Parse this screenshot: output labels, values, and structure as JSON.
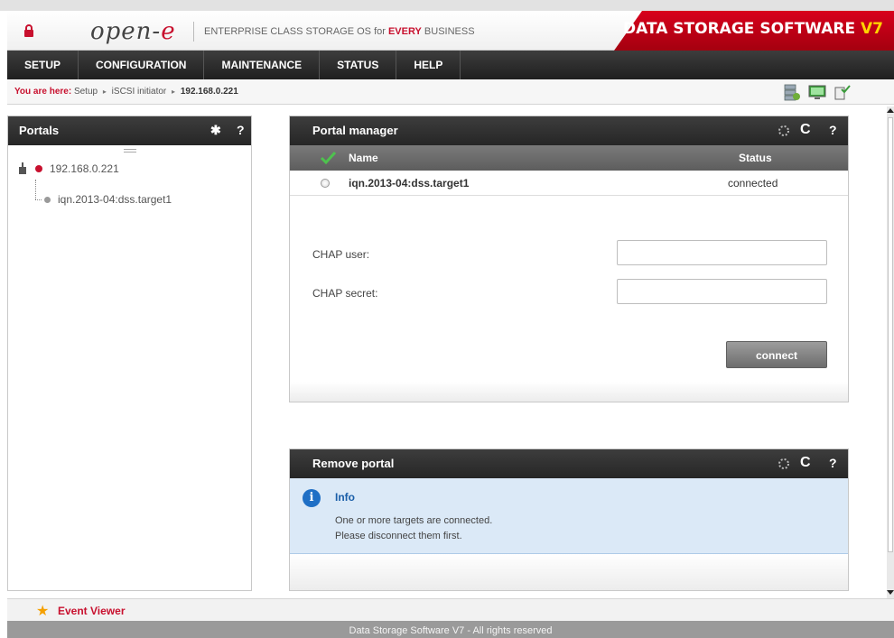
{
  "header": {
    "logo_main": "open-",
    "logo_accent": "e",
    "tagline_before": "ENTERPRISE CLASS STORAGE OS for ",
    "tagline_accent": "EVERY",
    "tagline_after": " BUSINESS",
    "product_title": "DATA STORAGE SOFTWARE ",
    "product_version": "V7"
  },
  "nav": {
    "items": [
      {
        "label": "SETUP"
      },
      {
        "label": "CONFIGURATION"
      },
      {
        "label": "MAINTENANCE"
      },
      {
        "label": "STATUS"
      },
      {
        "label": "HELP"
      }
    ]
  },
  "breadcrumb": {
    "label": "You are here:",
    "path": [
      "Setup",
      "iSCSI initiator",
      "192.168.0.221"
    ],
    "separator": "▸"
  },
  "left_panel": {
    "title": "Portals",
    "settings_icon": "gear-icon",
    "help_icon": "?",
    "tree": {
      "root": {
        "label": "192.168.0.221"
      },
      "child": {
        "label": "iqn.2013-04:dss.target1"
      }
    }
  },
  "portal_manager": {
    "title": "Portal manager",
    "refresh_icon": "C",
    "help_icon": "?",
    "columns": {
      "name": "Name",
      "status": "Status"
    },
    "rows": [
      {
        "name": "iqn.2013-04:dss.target1",
        "status": "connected"
      }
    ],
    "chap_user_label": "CHAP user:",
    "chap_secret_label": "CHAP secret:",
    "chap_user_value": "",
    "chap_secret_value": "",
    "connect_label": "connect"
  },
  "remove_portal": {
    "title": "Remove portal",
    "refresh_icon": "C",
    "help_icon": "?",
    "info_title": "Info",
    "info_line1": "One or more targets are connected.",
    "info_line2": "Please disconnect them first."
  },
  "event_viewer": {
    "label": "Event Viewer"
  },
  "footer": {
    "text": "Data Storage Software V7 - All rights reserved"
  },
  "colors": {
    "brand_red": "#c8102e",
    "version_yellow": "#ffd400",
    "info_blue": "#1f6fc5"
  }
}
